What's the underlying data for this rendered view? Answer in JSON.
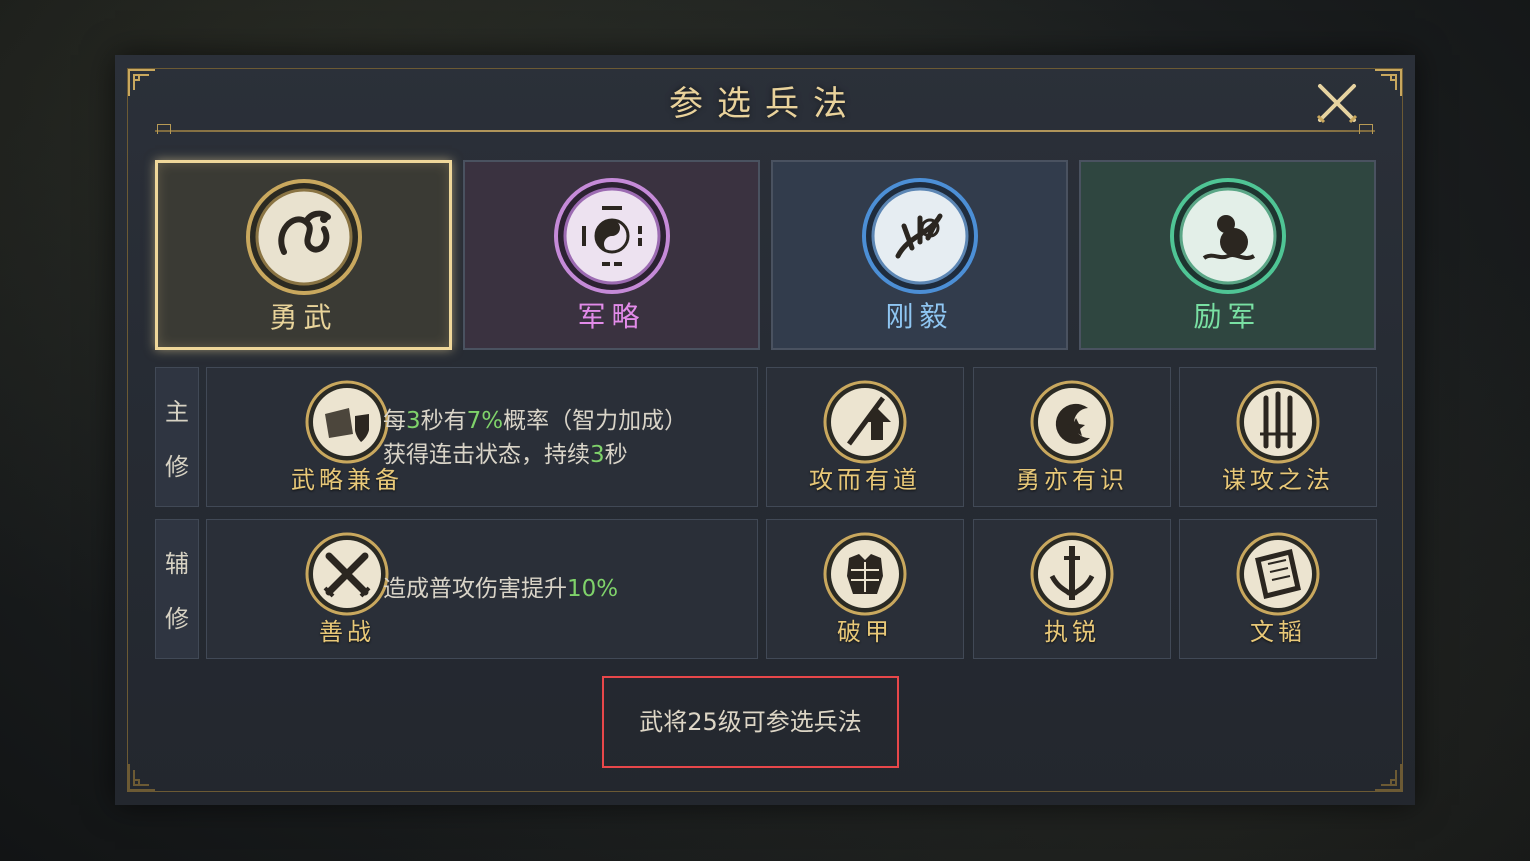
{
  "dialog": {
    "title": "参选兵法"
  },
  "types": [
    {
      "label": "勇武",
      "color": "#e9d49a",
      "icon": "dragon-emblem-icon",
      "bg": "#3a3a34",
      "selected": true
    },
    {
      "label": "军略",
      "color": "#e28be9",
      "icon": "taiji-emblem-icon",
      "bg": "#3a3240",
      "selected": false
    },
    {
      "label": "刚毅",
      "color": "#8fc6f2",
      "icon": "phoenix-emblem-icon",
      "bg": "#323c4c",
      "selected": false
    },
    {
      "label": "励军",
      "color": "#79e0a3",
      "icon": "gourd-emblem-icon",
      "bg": "#2f4640",
      "selected": false
    }
  ],
  "main_row": {
    "label_1": "主",
    "label_2": "修",
    "selected_skill": {
      "name": "武略兼备",
      "icon": "scroll-shield-icon",
      "desc_line1_a": "每",
      "desc_line1_b": "3",
      "desc_line1_c": "秒有",
      "desc_line1_d": "7%",
      "desc_line1_e": "概率（智力加成）",
      "desc_line2_a": "获得连击状态，持续",
      "desc_line2_b": "3",
      "desc_line2_c": "秒"
    },
    "skills": [
      {
        "name": "攻而有道",
        "icon": "spear-arrow-icon"
      },
      {
        "name": "勇亦有识",
        "icon": "crescent-star-icon"
      },
      {
        "name": "谋攻之法",
        "icon": "three-swords-icon"
      }
    ]
  },
  "sub_row": {
    "label_1": "辅",
    "label_2": "修",
    "selected_skill": {
      "name": "善战",
      "icon": "crossed-swords-icon",
      "desc_a": "造成普攻伤害提升",
      "desc_b": "10%"
    },
    "skills": [
      {
        "name": "破甲",
        "icon": "armor-icon"
      },
      {
        "name": "执锐",
        "icon": "sword-wings-icon"
      },
      {
        "name": "文韬",
        "icon": "scroll-icon"
      }
    ]
  },
  "footer": {
    "note": "武将25级可参选兵法"
  },
  "colors": {
    "gold": "#e8c878",
    "highlight_green": "#7fd26a",
    "note_border": "#e8474a"
  }
}
